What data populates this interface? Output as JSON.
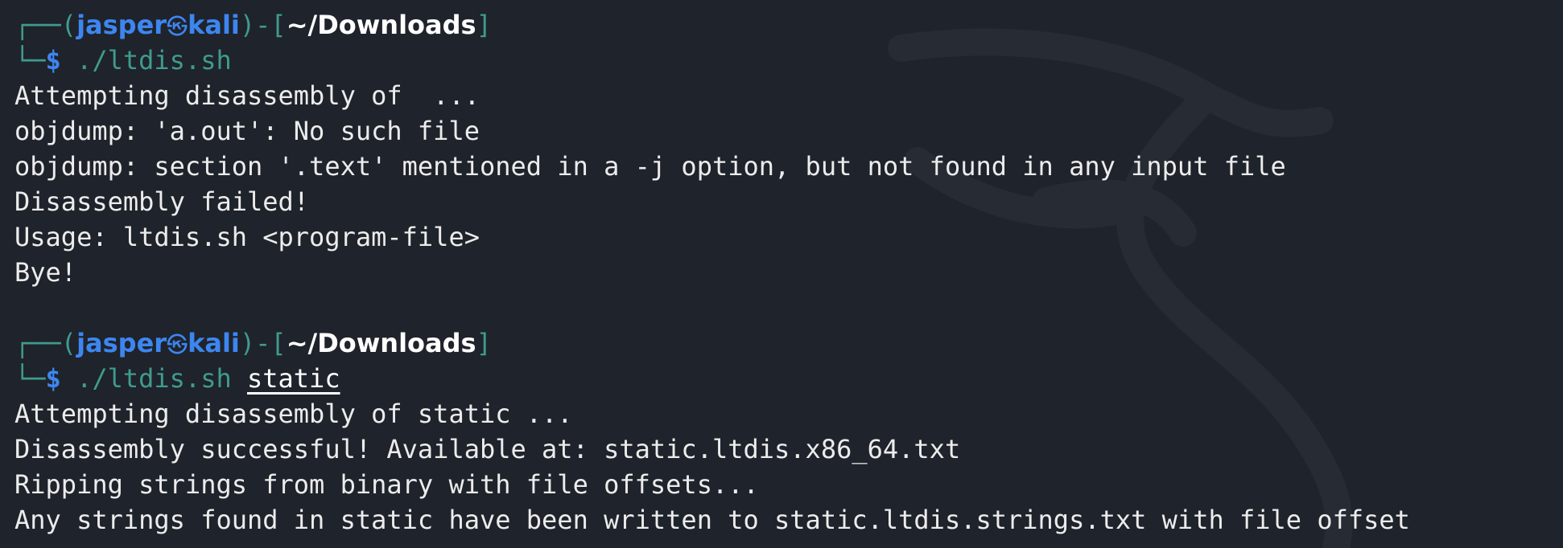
{
  "colors": {
    "background": "#1f232b",
    "prompt_frame": "#3f9b8e",
    "user_host": "#3d86f0",
    "path": "#ffffff",
    "output": "#ececec"
  },
  "prompt_1": {
    "corner_top": "┌──",
    "open_paren": "(",
    "user": "jasper",
    "separator_icon": "㉿",
    "host": "kali",
    "close_bracket_open": ")-[",
    "cwd": "~/Downloads",
    "close_bracket": "]",
    "corner_bottom": "└─",
    "dollar": "$",
    "command": "./ltdis.sh",
    "argument": ""
  },
  "output_1": [
    "Attempting disassembly of  ...",
    "objdump: 'a.out': No such file",
    "objdump: section '.text' mentioned in a -j option, but not found in any input file",
    "Disassembly failed!",
    "Usage: ltdis.sh <program-file>",
    "Bye!"
  ],
  "prompt_2": {
    "corner_top": "┌──",
    "open_paren": "(",
    "user": "jasper",
    "separator_icon": "㉿",
    "host": "kali",
    "close_bracket_open": ")-[",
    "cwd": "~/Downloads",
    "close_bracket": "]",
    "corner_bottom": "└─",
    "dollar": "$",
    "command": "./ltdis.sh",
    "argument": "static"
  },
  "output_2": [
    "Attempting disassembly of static ...",
    "Disassembly successful! Available at: static.ltdis.x86_64.txt",
    "Ripping strings from binary with file offsets...",
    "Any strings found in static have been written to static.ltdis.strings.txt with file offset"
  ]
}
